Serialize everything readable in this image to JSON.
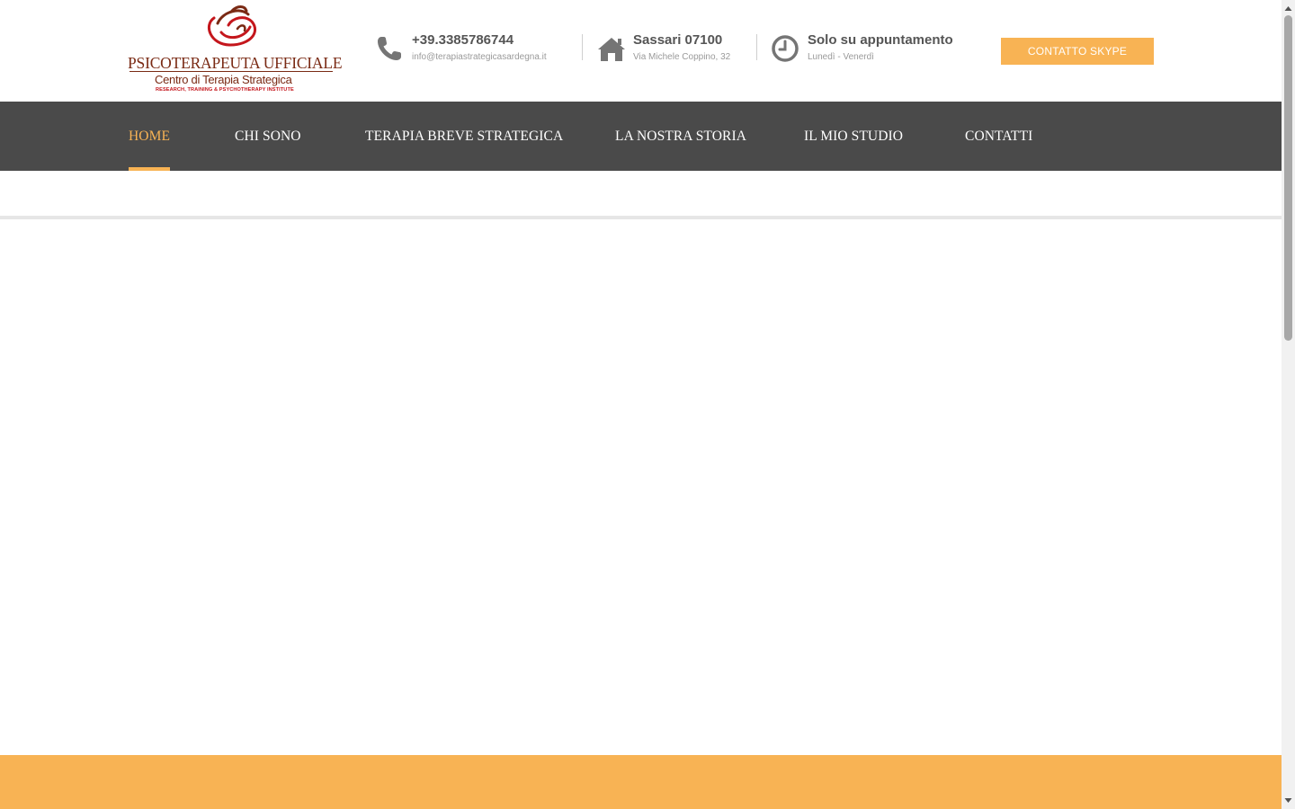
{
  "logo": {
    "title": "PSICOTERAPEUTA UFFICIALE",
    "subtitle": "Centro di Terapia Strategica",
    "tagline": "RESEARCH, TRAINING & PSYCHOTHERAPY INSTITUTE"
  },
  "contact": {
    "phone": "+39.3385786744",
    "email": "info@terapiastrategicasardegna.it",
    "city": "Sassari 07100",
    "address": "Via Michele Coppino, 32",
    "hours_title": "Solo su appuntamento",
    "hours_days": "Lunedì - Venerdì",
    "icons": [
      "phone-icon",
      "home-icon",
      "clock-icon"
    ]
  },
  "skype_button": "CONTATTO SKYPE",
  "nav": {
    "items": [
      {
        "label": "HOME",
        "active": true
      },
      {
        "label": "CHI SONO",
        "active": false
      },
      {
        "label": "TERAPIA BREVE STRATEGICA",
        "active": false
      },
      {
        "label": "LA NOSTRA STORIA",
        "active": false
      },
      {
        "label": "IL MIO STUDIO",
        "active": false
      },
      {
        "label": "CONTATTI",
        "active": false
      }
    ]
  },
  "colors": {
    "accent": "#f8b354",
    "nav_bg": "#4a4a4a",
    "brand": "#7a2a14",
    "logo_red": "#c4161c"
  }
}
